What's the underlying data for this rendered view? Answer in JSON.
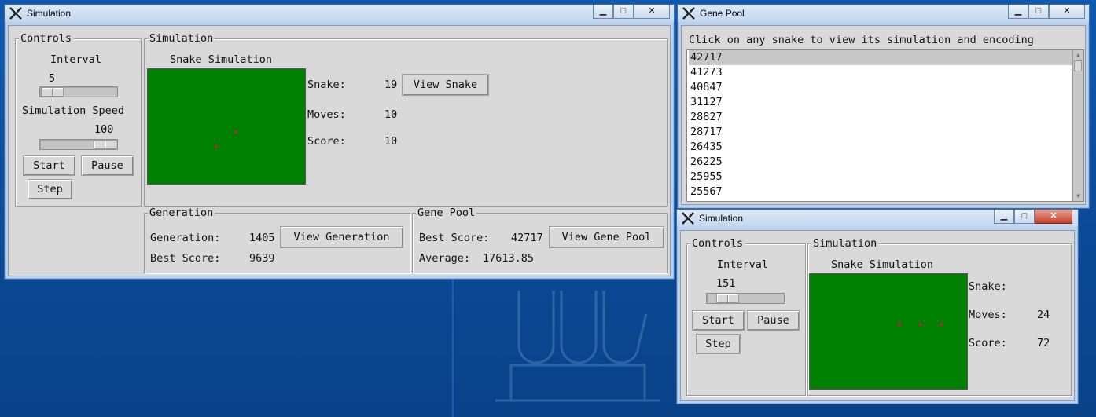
{
  "desktop": {
    "background": "#0d4f9f"
  },
  "main_window": {
    "title": "Simulation",
    "minimize": "▁",
    "maximize": "□",
    "close": "✕",
    "controls": {
      "label": "Controls",
      "interval_label": "Interval",
      "interval_value": "5",
      "speed_label": "Simulation Speed",
      "speed_value": "100",
      "start": "Start",
      "pause": "Pause",
      "step": "Step"
    },
    "simulation": {
      "label": "Simulation",
      "board_title": "Snake Simulation",
      "snake_label": "Snake:",
      "snake_value": "19",
      "view_snake": "View Snake",
      "moves_label": "Moves:",
      "moves_value": "10",
      "score_label": "Score:",
      "score_value": "10"
    },
    "generation": {
      "label": "Generation",
      "gen_label": "Generation:",
      "gen_value": "1405",
      "view_generation": "View Generation",
      "best_label": "Best Score:",
      "best_value": "9639"
    },
    "gene_pool": {
      "label": "Gene Pool",
      "best_label": "Best Score:",
      "best_value": "42717",
      "view_gene_pool": "View Gene Pool",
      "avg_label": "Average:",
      "avg_value": "17613.85"
    }
  },
  "gene_pool_window": {
    "title": "Gene Pool",
    "minimize": "▁",
    "maximize": "□",
    "close": "✕",
    "instruction": "Click on any snake to view its simulation and encoding",
    "scores": [
      "42717",
      "41273",
      "40847",
      "31127",
      "28827",
      "28717",
      "26435",
      "26225",
      "25955",
      "25567"
    ],
    "scroll_up": "▲",
    "scroll_down": "▼"
  },
  "sim_window2": {
    "title": "Simulation",
    "minimize": "▁",
    "maximize": "□",
    "close": "✕",
    "controls": {
      "label": "Controls",
      "interval_label": "Interval",
      "interval_value": "151",
      "start": "Start",
      "pause": "Pause",
      "step": "Step"
    },
    "simulation": {
      "label": "Simulation",
      "board_title": "Snake Simulation",
      "snake_label": "Snake:",
      "snake_value": "",
      "moves_label": "Moves:",
      "moves_value": "24",
      "score_label": "Score:",
      "score_value": "72"
    }
  }
}
